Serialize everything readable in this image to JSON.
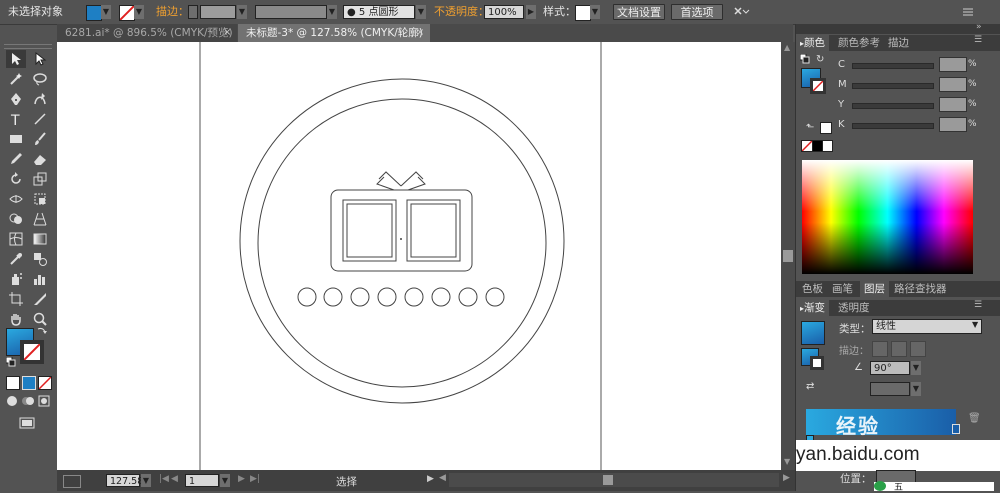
{
  "control_bar": {
    "selection_status": "未选择对象",
    "fill_color": "#1e7fc4",
    "stroke_label": "描边：",
    "brush_preset": "5 点圆形",
    "opacity_label": "不透明度：",
    "opacity_value": "100%",
    "style_label": "样式：",
    "doc_setup_button": "文档设置",
    "preferences_button": "首选项"
  },
  "document_tabs": [
    {
      "label": "6281.ai* @ 896.5% (CMYK/预览)",
      "close": "×",
      "active": false
    },
    {
      "label": "未标题-3* @ 127.58% (CMYK/轮廓)",
      "close": "×",
      "active": true
    }
  ],
  "status_bar": {
    "zoom": "127.58",
    "page": "1",
    "tool_status": "选择"
  },
  "color_panel": {
    "tabs": [
      "颜色",
      "颜色参考",
      "描边"
    ],
    "channels": [
      {
        "name": "C",
        "unit": "%"
      },
      {
        "name": "M",
        "unit": "%"
      },
      {
        "name": "Y",
        "unit": "%"
      },
      {
        "name": "K",
        "unit": "%"
      }
    ]
  },
  "layers_panel": {
    "tabs": [
      "色板",
      "画笔",
      "图层",
      "路径查找器"
    ]
  },
  "gradient_panel": {
    "tabs": [
      "渐变",
      "透明度"
    ],
    "type_label": "类型：",
    "type_value": "线性",
    "stroke_label": "描边：",
    "angle_value": "90°",
    "position_label": "位置："
  },
  "watermark": {
    "text": "yan.baidu.com",
    "brand": "经验"
  },
  "taskbar_ime": {
    "text": "五"
  },
  "colors": {
    "accent_blue": "#1e7fc4",
    "gradient_start": "#2aa9e0",
    "gradient_end": "#1a5ea8",
    "panel_bg": "#535353",
    "canvas_bg": "#ffffff"
  }
}
